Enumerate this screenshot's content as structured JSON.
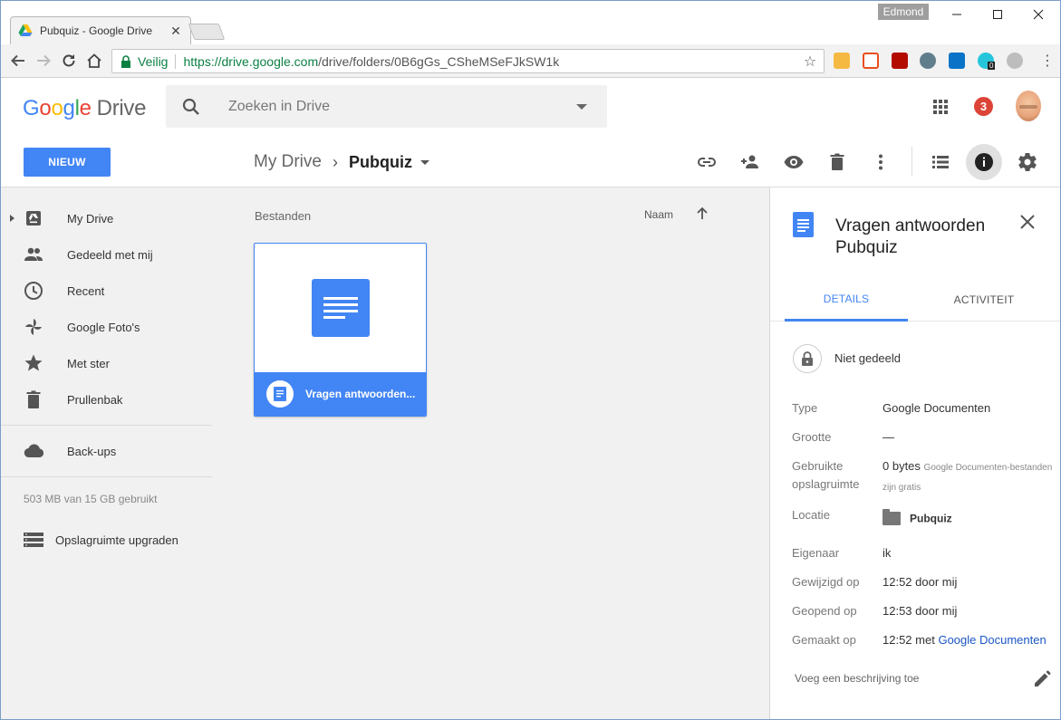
{
  "browser": {
    "tab_title": "Pubquiz - Google Drive",
    "tab_close": "✕",
    "profile_name": "Edmond",
    "secure_label": "Veilig",
    "url_host": "https://drive.google.com",
    "url_path": "/drive/folders/0B6gGs_CSheMSeFJkSW1k",
    "ext_badge": "0"
  },
  "drive": {
    "logo_google": [
      "G",
      "o",
      "o",
      "g",
      "l",
      "e"
    ],
    "logo_product": "Drive",
    "search_placeholder": "Zoeken in Drive",
    "notification_count": "3",
    "new_button": "NIEUW",
    "breadcrumb_root": "My Drive",
    "breadcrumb_sep": "›",
    "breadcrumb_current": "Pubquiz"
  },
  "sidebar": {
    "items": [
      {
        "label": "My Drive",
        "icon": "my-drive-icon"
      },
      {
        "label": "Gedeeld met mij",
        "icon": "people-icon"
      },
      {
        "label": "Recent",
        "icon": "clock-icon"
      },
      {
        "label": "Google Foto's",
        "icon": "pinwheel-icon"
      },
      {
        "label": "Met ster",
        "icon": "star-icon"
      },
      {
        "label": "Prullenbak",
        "icon": "trash-icon"
      }
    ],
    "backups_label": "Back-ups",
    "storage_text": "503 MB van 15 GB gebruikt",
    "upgrade_label": "Opslagruimte upgraden"
  },
  "main": {
    "files_header": "Bestanden",
    "sort_label": "Naam",
    "file": {
      "name": "Vragen antwoorden..."
    }
  },
  "details": {
    "title": "Vragen antwoorden Pubquiz",
    "tabs": [
      "DETAILS",
      "ACTIVITEIT"
    ],
    "sharing": "Niet gedeeld",
    "props": {
      "type_k": "Type",
      "type_v": "Google Documenten",
      "size_k": "Grootte",
      "size_v": "—",
      "used_k": "Gebruikte opslagruimte",
      "used_v": "0 bytes",
      "used_note": "Google Documenten-bestanden zijn gratis",
      "loc_k": "Locatie",
      "loc_v": "Pubquiz",
      "owner_k": "Eigenaar",
      "owner_v": "ik",
      "modified_k": "Gewijzigd op",
      "modified_v": "12:52 door mij",
      "opened_k": "Geopend op",
      "opened_v": "12:53 door mij",
      "created_k": "Gemaakt op",
      "created_v": "12:52 met",
      "created_link": "Google Documenten"
    },
    "description_placeholder": "Voeg een beschrijving toe"
  },
  "colors": {
    "accent": "#4285f4",
    "badge_red": "#db4437",
    "secure_green": "#0b8043"
  }
}
